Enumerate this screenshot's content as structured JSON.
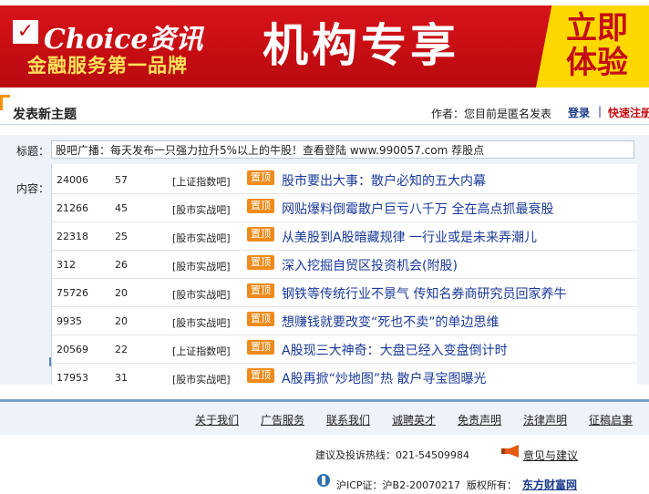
{
  "banner": {
    "logo_mark": "✓",
    "logo_text": "Choice资讯",
    "tagline": "金融服务第一品牌",
    "slogan": "机构专享",
    "cta": "立即体验"
  },
  "post": {
    "title": "发表新主题",
    "author_label": "作者：您目前是匿名发表",
    "login_link": "登录",
    "separator": "|",
    "register_link": "快速注册"
  },
  "form": {
    "title_label": "标题：",
    "content_label": "内容：",
    "title_value": "股吧广播：每天发布一只强力拉升5%以上的牛股！查看登陆 www.990057.com 荐股点"
  },
  "rows": [
    {
      "views": "24006",
      "replies": "57",
      "category": "[上证指数吧]",
      "badge": "置顶",
      "title": "股市要出大事：散户必知的五大内幕"
    },
    {
      "views": "21266",
      "replies": "45",
      "category": "[股市实战吧]",
      "badge": "置顶",
      "title": "网贴爆料倒霉散户巨亏八千万 全在高点抓最衰股"
    },
    {
      "views": "22318",
      "replies": "25",
      "category": "[股市实战吧]",
      "badge": "置顶",
      "title": "从美股到A股暗藏规律 一行业或是未来弄潮儿"
    },
    {
      "views": "312",
      "replies": "26",
      "category": "[股市实战吧]",
      "badge": "置顶",
      "title": "深入挖掘自贸区投资机会(附股)"
    },
    {
      "views": "75726",
      "replies": "20",
      "category": "[股市实战吧]",
      "badge": "置顶",
      "title": "钢铁等传统行业不景气 传知名券商研究员回家养牛"
    },
    {
      "views": "9935",
      "replies": "20",
      "category": "[股市实战吧]",
      "badge": "置顶",
      "title": "想赚钱就要改变“死也不卖”的单边思维"
    },
    {
      "views": "20569",
      "replies": "22",
      "category": "[上证指数吧]",
      "badge": "置顶",
      "title": "A股现三大神奇：大盘已经入变盘倒计时"
    },
    {
      "views": "17953",
      "replies": "31",
      "category": "[股市实战吧]",
      "badge": "置顶",
      "title": "A股再掀“炒地图”热 散户寻宝图曝光"
    }
  ],
  "footer": {
    "links": [
      "关于我们",
      "广告服务",
      "联系我们",
      "诚聘英才",
      "免责声明",
      "法律声明",
      "征稿启事"
    ],
    "hotline": "建议及投诉热线：021-54509984",
    "feedback": "意见与建议",
    "icp": "沪ICP证：沪B2-20070217",
    "copyright": "版权所有：",
    "site": "东方财富网"
  },
  "colors": {
    "brand_red": "#c40d12",
    "accent_yellow": "#ffd800",
    "badge_orange": "#ef8b1c",
    "link_blue": "#1a3a9a"
  }
}
